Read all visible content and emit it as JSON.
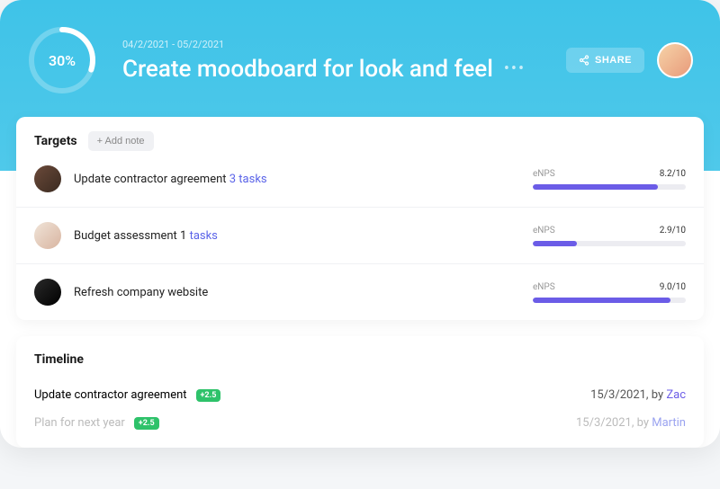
{
  "header": {
    "progress_pct": "30%",
    "date_range": "04/2/2021 - 05/2/2021",
    "title": "Create moodboard for look and feel",
    "share_label": "SHARE"
  },
  "targets": {
    "title": "Targets",
    "add_note_label": "+ Add note",
    "items": [
      {
        "name": "Update contractor agreement",
        "tasks_text": "3 tasks",
        "metric_label": "eNPS",
        "score": "8.2/10",
        "fill_pct": 82,
        "avatar_class": "a1"
      },
      {
        "name": "Budget assessment 1",
        "tasks_text": "tasks",
        "metric_label": "eNPS",
        "score": "2.9/10",
        "fill_pct": 29,
        "avatar_class": "a2"
      },
      {
        "name": "Refresh company website",
        "tasks_text": "",
        "metric_label": "eNPS",
        "score": "9.0/10",
        "fill_pct": 90,
        "avatar_class": "a3"
      }
    ]
  },
  "timeline": {
    "title": "Timeline",
    "items": [
      {
        "name": "Update contractor agreement",
        "badge": "+2.5",
        "date": "15/3/2021",
        "by": "by",
        "author": "Zac",
        "faded": false
      },
      {
        "name": "Plan for next year",
        "badge": "+2.5",
        "date": "15/3/2021",
        "by": "by",
        "author": "Martin",
        "faded": true
      }
    ]
  }
}
